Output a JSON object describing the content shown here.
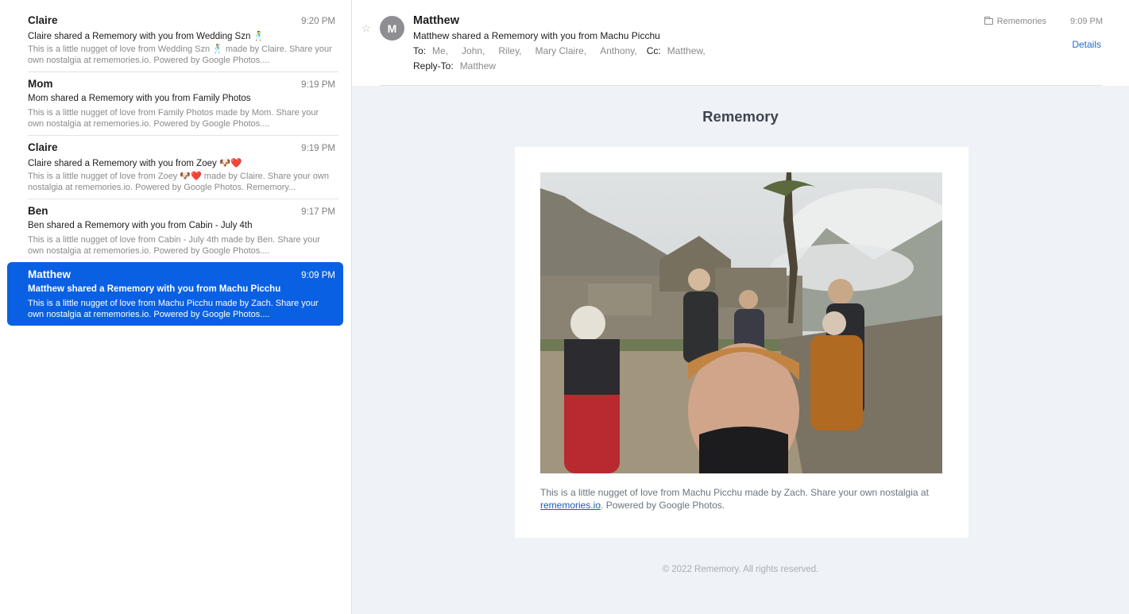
{
  "messages": [
    {
      "sender": "Claire",
      "time": "9:20 PM",
      "subject": "Claire shared a Rememory with you from Wedding Szn 🕺",
      "preview": "This is a little nugget of love from Wedding Szn 🕺 made by Claire. Share your own nostalgia at rememories.io. Powered by Google Photos...."
    },
    {
      "sender": "Mom",
      "time": "9:19 PM",
      "subject": "Mom shared a Rememory with you from Family Photos",
      "preview": "This is a little nugget of love from Family Photos made by Mom. Share your own nostalgia at rememories.io. Powered by Google Photos...."
    },
    {
      "sender": "Claire",
      "time": "9:19 PM",
      "subject": "Claire shared a Rememory with you from Zoey 🐶❤️",
      "preview": "This is a little nugget of love from Zoey 🐶❤️ made by Claire. Share your own nostalgia at rememories.io. Powered by Google Photos. Rememory..."
    },
    {
      "sender": "Ben",
      "time": "9:17 PM",
      "subject": "Ben shared a Rememory with you from Cabin - July 4th",
      "preview": "This is a little nugget of love from Cabin - July 4th made by Ben. Share your own nostalgia at rememories.io. Powered by Google Photos...."
    },
    {
      "sender": "Matthew",
      "time": "9:09 PM",
      "subject": "Matthew shared a Rememory with you from Machu Picchu",
      "preview": "This is a little nugget of love from Machu Picchu made by Zach. Share your own nostalgia at rememories.io. Powered by Google Photos...."
    }
  ],
  "selected_index": 4,
  "header": {
    "avatar_initial": "M",
    "from": "Matthew",
    "subject": "Matthew shared a Rememory with you from Machu Picchu",
    "to_label": "To:",
    "to": [
      "Me,",
      "John,",
      "Riley,",
      "Mary Claire,",
      "Anthony,"
    ],
    "cc_label": "Cc:",
    "cc": [
      "Matthew,"
    ],
    "reply_to_label": "Reply-To:",
    "reply_to": "Matthew",
    "folder": "Rememories",
    "time": "9:09 PM",
    "details_label": "Details",
    "star_glyph": "☆"
  },
  "email": {
    "brand": "Rememory",
    "caption_before": "This is a little nugget of love from Machu Picchu made by Zach. Share your own nostalgia at ",
    "caption_link": "rememories.io",
    "caption_after": ". Powered by Google Photos.",
    "footer": "© 2022 Rememory. All rights reserved."
  },
  "colors": {
    "selection": "#0a60e3",
    "link": "#1f6cd1",
    "email_background": "#eff2f6"
  }
}
